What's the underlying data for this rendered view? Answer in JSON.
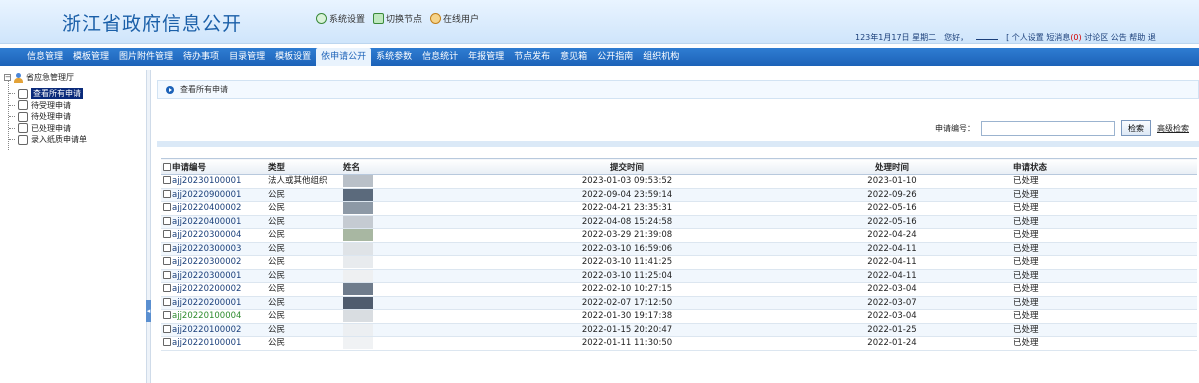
{
  "header": {
    "site_title": "浙江省政府信息公开",
    "links": [
      {
        "label": "系统设置",
        "icon": "gear-icon"
      },
      {
        "label": "切换节点",
        "icon": "switch-node-icon"
      },
      {
        "label": "在线用户",
        "icon": "online-users-icon"
      }
    ],
    "date": "123年1月17日 星期二",
    "greeting": "您好，",
    "user_links": [
      "[ 个人设置",
      "短消息",
      "讨论区",
      "公告",
      "帮助",
      "退"
    ],
    "unread": "(0)"
  },
  "nav": {
    "items": [
      "信息管理",
      "模板管理",
      "图片附件管理",
      "待办事项",
      "目录管理",
      "模板设置",
      "依申请公开",
      "系统参数",
      "信息统计",
      "年报管理",
      "节点发布",
      "意见箱",
      "公开指南",
      "组织机构"
    ],
    "active_index": 6
  },
  "sidebar": {
    "root": "省应急管理厅",
    "items": [
      "查看所有申请",
      "待受理申请",
      "待处理申请",
      "已处理申请",
      "录入纸质申请单"
    ],
    "active_index": 0
  },
  "main": {
    "title": "查看所有申请",
    "search_label": "申请编号：",
    "search_value": "",
    "search_button": "检索",
    "advanced": "高级检索"
  },
  "table": {
    "headers": [
      "申请编号",
      "类型",
      "姓名",
      "提交时间",
      "处理时间",
      "申请状态"
    ],
    "rows": [
      {
        "id": "ajj20230100001",
        "type": "法人或其他组织",
        "name": "",
        "submitted": "2023-01-03 09:53:52",
        "processed": "2023-01-10",
        "status": "已处理"
      },
      {
        "id": "ajj20220900001",
        "type": "公民",
        "name": "",
        "submitted": "2022-09-04 23:59:14",
        "processed": "2022-09-26",
        "status": "已处理"
      },
      {
        "id": "ajj20220400002",
        "type": "公民",
        "name": "",
        "submitted": "2022-04-21 23:35:31",
        "processed": "2022-05-16",
        "status": "已处理"
      },
      {
        "id": "ajj20220400001",
        "type": "公民",
        "name": "",
        "submitted": "2022-04-08 15:24:58",
        "processed": "2022-05-16",
        "status": "已处理"
      },
      {
        "id": "ajj20220300004",
        "type": "公民",
        "name": "",
        "submitted": "2022-03-29 21:39:08",
        "processed": "2022-04-24",
        "status": "已处理"
      },
      {
        "id": "ajj20220300003",
        "type": "公民",
        "name": "",
        "submitted": "2022-03-10 16:59:06",
        "processed": "2022-04-11",
        "status": "已处理"
      },
      {
        "id": "ajj20220300002",
        "type": "公民",
        "name": "",
        "submitted": "2022-03-10 11:41:25",
        "processed": "2022-04-11",
        "status": "已处理"
      },
      {
        "id": "ajj20220300001",
        "type": "公民",
        "name": "",
        "submitted": "2022-03-10 11:25:04",
        "processed": "2022-04-11",
        "status": "已处理"
      },
      {
        "id": "ajj20220200002",
        "type": "公民",
        "name": "",
        "submitted": "2022-02-10 10:27:15",
        "processed": "2022-03-04",
        "status": "已处理"
      },
      {
        "id": "ajj20220200001",
        "type": "公民",
        "name": "",
        "submitted": "2022-02-07 17:12:50",
        "processed": "2022-03-07",
        "status": "已处理"
      },
      {
        "id": "ajj20220100004",
        "type": "公民",
        "name": "",
        "submitted": "2022-01-30 19:17:38",
        "processed": "2022-03-04",
        "status": "已处理",
        "highlight": true
      },
      {
        "id": "ajj20220100002",
        "type": "公民",
        "name": "",
        "submitted": "2022-01-15 20:20:47",
        "processed": "2022-01-25",
        "status": "已处理"
      },
      {
        "id": "ajj20220100001",
        "type": "公民",
        "name": "",
        "submitted": "2022-01-11 11:30:50",
        "processed": "2022-01-24",
        "status": "已处理"
      }
    ]
  },
  "colors": {
    "nav_bg": "#1c62b8",
    "title": "#1a5fa8",
    "redacted": "#5b6a7c"
  }
}
